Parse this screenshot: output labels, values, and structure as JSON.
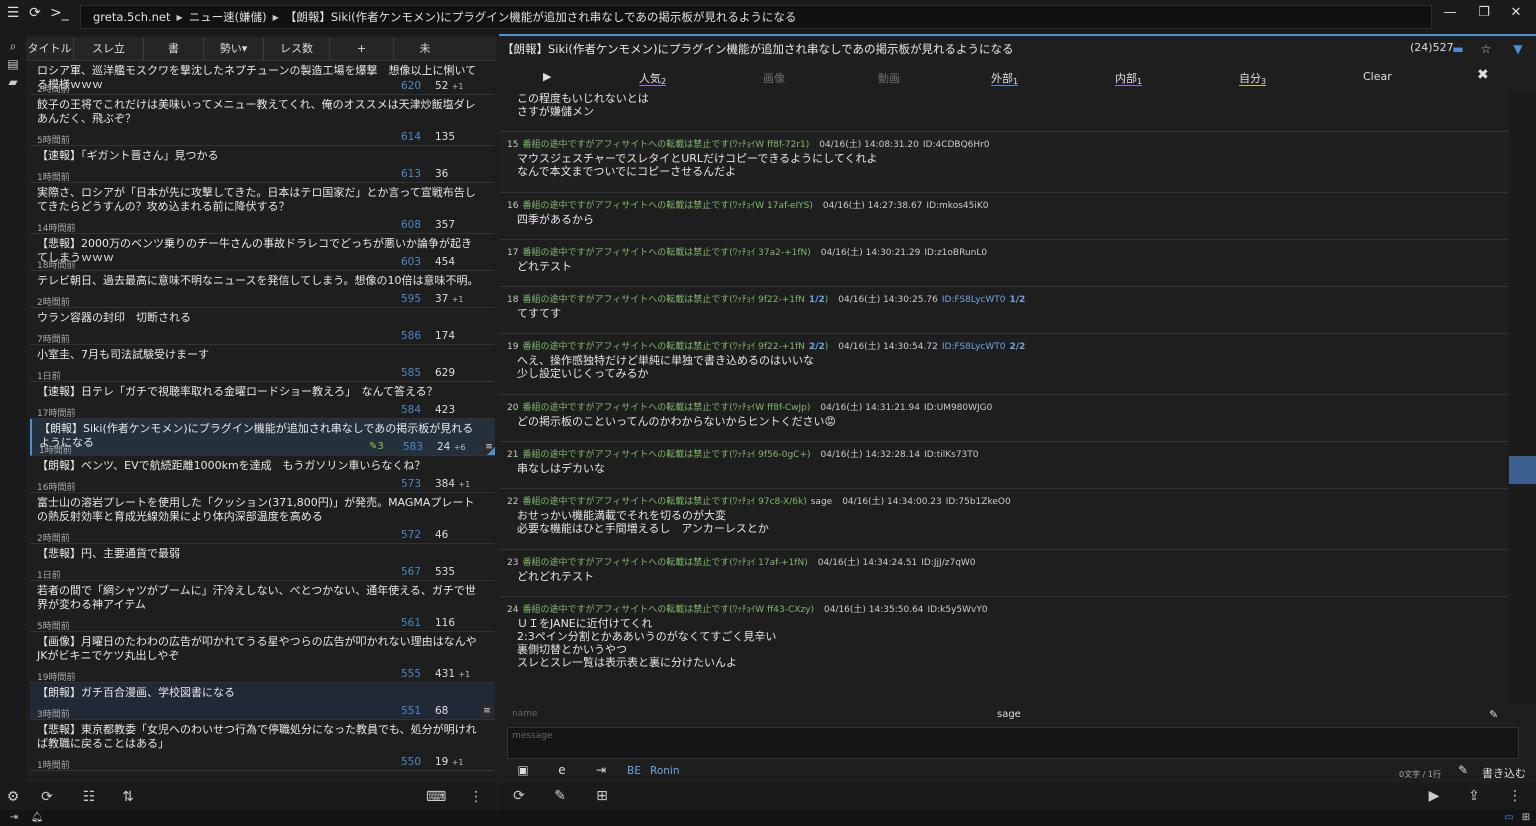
{
  "titlebar": {
    "crumbs": [
      "greta.5ch.net",
      "ニュー速(嫌儲)",
      "【朗報】Siki(作者ケンモメン)にプラグイン機能が追加され串なしであの掲示板が見れるようになる"
    ],
    "icons": [
      "menu-icon",
      "refresh-icon",
      "terminal-icon"
    ],
    "window_buttons": [
      "—",
      "❐",
      "✕"
    ]
  },
  "thread_header": {
    "columns": [
      "タイトル",
      "スレ立",
      "書",
      "勢い▾",
      "レス数",
      "+",
      "未"
    ]
  },
  "threads": [
    {
      "title": "ロシア軍、巡洋艦モスクワを撃沈したネプチューンの製造工場を爆撃　想像以上に悧いてる模様ｗｗｗ",
      "age": "2時間前",
      "num": "620",
      "cnt": "52",
      "plus": "+1"
    },
    {
      "title": "餃子の王将でこれだけは美味いってメニュー教えてくれ、俺のオススメは天津炒飯塩ダレあんだく、飛ぶぞ？",
      "age": "5時間前",
      "num": "614",
      "cnt": "135",
      "plus": ""
    },
    {
      "title": "【速報】「ギガント晋さん」見つかる",
      "age": "1時間前",
      "num": "613",
      "cnt": "36",
      "plus": ""
    },
    {
      "title": "実際さ、ロシアが「日本が先に攻撃してきた。日本はテロ国家だ」とか言って宣戦布告してきたらどうすんの？攻め込まれる前に降伏する？",
      "age": "14時間前",
      "num": "608",
      "cnt": "357",
      "plus": ""
    },
    {
      "title": "【悲報】2000万のベンツ乗りのチー牛さんの事故ドラレコでどっちが悪いか論争が起きてしまうｗｗｗ",
      "age": "18時間前",
      "num": "603",
      "cnt": "454",
      "plus": ""
    },
    {
      "title": "テレビ朝日、過去最高に意味不明なニュースを発信してしまう。想像の10倍は意味不明。",
      "age": "2時間前",
      "num": "595",
      "cnt": "37",
      "plus": "+1"
    },
    {
      "title": "ウラン容器の封印　切断される",
      "age": "7時間前",
      "num": "586",
      "cnt": "174",
      "plus": ""
    },
    {
      "title": "小室圭、7月も司法試験受けまーす",
      "age": "1日前",
      "num": "585",
      "cnt": "629",
      "plus": ""
    },
    {
      "title": "【速報】日テレ「ガチで視聴率取れる金曜ロードショー教えろ」　なんて答える？",
      "age": "17時間前",
      "num": "584",
      "cnt": "423",
      "plus": ""
    },
    {
      "title": "【朗報】Siki(作者ケンモメン)にプラグイン機能が追加され串なしであの掲示板が見れるようになる",
      "age": "1時間前",
      "num": "583",
      "cnt": "24",
      "plus": "+6",
      "edit": "3",
      "selected": true
    },
    {
      "title": "【朗報】ベンツ、EVで航続距離1000kmを達成　もうガソリン車いらなくね？",
      "age": "16時間前",
      "num": "573",
      "cnt": "384",
      "plus": "+1"
    },
    {
      "title": "富士山の溶岩プレートを使用した「クッション(371,800円)」が発売。MAGMAプレートの熱反射効率と育成光線効果により体内深部温度を高める",
      "age": "2時間前",
      "num": "572",
      "cnt": "46",
      "plus": ""
    },
    {
      "title": "【悲報】円、主要通貨で最弱",
      "age": "1日前",
      "num": "567",
      "cnt": "535",
      "plus": ""
    },
    {
      "title": "若者の間で「網シャツがブームに」汗冷えしない、べとつかない、通年使える、ガチで世界が変わる神アイテム",
      "age": "5時間前",
      "num": "561",
      "cnt": "116",
      "plus": ""
    },
    {
      "title": "【画像】月曜日のたわわの広告が叩かれてうる星やつらの広告が叩かれない理由はなんや JKがビキニでケツ丸出しやぞ",
      "age": "19時間前",
      "num": "555",
      "cnt": "431",
      "plus": "+1"
    },
    {
      "title": "【朗報】ガチ百合漫画、学校図書になる",
      "age": "3時間前",
      "num": "551",
      "cnt": "68",
      "plus": "",
      "highlight": true
    },
    {
      "title": "【悲報】東京都教委「女児へのわいせつ行為で停職処分になった教員でも、処分が明ければ教職に戻ることはある」",
      "age": "1時間前",
      "num": "550",
      "cnt": "19",
      "plus": "+1"
    }
  ],
  "right": {
    "title": "【朗報】Siki(作者ケンモメン)にプラグイン機能が追加され串なしであの掲示板が見れるようになる",
    "res_count": "(24)527",
    "tabs": [
      {
        "label": "▶",
        "sub": "",
        "dim": false
      },
      {
        "label": "人気",
        "sub": "2",
        "dim": false,
        "ul": "ul-purple"
      },
      {
        "label": "画像",
        "sub": "",
        "dim": true
      },
      {
        "label": "動画",
        "sub": "",
        "dim": true
      },
      {
        "label": "外部",
        "sub": "1",
        "dim": false,
        "ul": "ul-blue"
      },
      {
        "label": "内部",
        "sub": "1",
        "dim": false,
        "ul": "ul-purple"
      },
      {
        "label": "自分",
        "sub": "3",
        "dim": false,
        "ul": "ul-yellow"
      },
      {
        "label": "Clear",
        "sub": "",
        "dim": false
      }
    ],
    "clear_x": "✖",
    "first_body": "この程度もいじれないとは\nさすが嫌儲メン",
    "posts": [
      {
        "no": "15",
        "name": "番組の途中ですがアフィサイトへの転載は禁止です(ﾜｯﾁｮｲW ff8f-72r1)",
        "mail": "",
        "date": "04/16(土) 14:08:31.20",
        "id": "ID:4CDBQ6Hr0",
        "idcnt": "",
        "body": "マウスジェスチャーでスレタイとURLだけコピーできるようにしてくれよ\nなんで本文までついでにコピーさせるんだよ"
      },
      {
        "no": "16",
        "name": "番組の途中ですがアフィサイトへの転載は禁止です(ﾜｯﾁｮｲW 17af-eIYS)",
        "mail": "",
        "date": "04/16(土) 14:27:38.67",
        "id": "ID:mkos45iK0",
        "idcnt": "",
        "body": "四季があるから"
      },
      {
        "no": "17",
        "name": "番組の途中ですがアフィサイトへの転載は禁止です(ﾜｯﾁｮｲ 37a2-+1fN)",
        "mail": "",
        "date": "04/16(土) 14:30:21.29",
        "id": "ID:z1oBRunL0",
        "idcnt": "",
        "body": "どれテスト"
      },
      {
        "no": "18",
        "name": "番組の途中ですがアフィサイトへの転載は禁止です(ﾜｯﾁｮｲ 9f22-+1fN",
        "namecnt": "1/2",
        "mail": "",
        "date": "04/16(土) 14:30:25.76",
        "id": "ID:FS8LycWT0",
        "idcnt": "1/2",
        "body": "てすてす"
      },
      {
        "no": "19",
        "name": "番組の途中ですがアフィサイトへの転載は禁止です(ﾜｯﾁｮｲ 9f22-+1fN",
        "namecnt": "2/2",
        "mail": "",
        "date": "04/16(土) 14:30:54.72",
        "id": "ID:FS8LycWT0",
        "idcnt": "2/2",
        "body": "へえ、操作感独特だけど単純に単独で書き込めるのはいいな\n少し設定いじくってみるか"
      },
      {
        "no": "20",
        "name": "番組の途中ですがアフィサイトへの転載は禁止です(ﾜｯﾁｮｲW ff8f-CwJp)",
        "mail": "",
        "date": "04/16(土) 14:31:21.94",
        "id": "ID:UM980WJG0",
        "idcnt": "",
        "body": "どの掲示板のこといってんのかわからないからヒントください😡"
      },
      {
        "no": "21",
        "name": "番組の途中ですがアフィサイトへの転載は禁止です(ﾜｯﾁｮｲ 9f56-0gC+)",
        "mail": "",
        "date": "04/16(土) 14:32:28.14",
        "id": "ID:tilKs73T0",
        "idcnt": "",
        "body": "串なしはデカいな"
      },
      {
        "no": "22",
        "name": "番組の途中ですがアフィサイトへの転載は禁止です(ﾜｯﾁｮｲ 97c8-X/6k)",
        "mail": "sage",
        "date": "04/16(土) 14:34:00.23",
        "id": "ID:75b1ZkeO0",
        "idcnt": "",
        "body": "おせっかい機能満載でそれを切るのが大変\n必要な機能はひと手間増えるし　アンカーレスとか"
      },
      {
        "no": "23",
        "name": "番組の途中ですがアフィサイトへの転載は禁止です(ﾜｯﾁｮｲ 17af-+1fN)",
        "mail": "",
        "date": "04/16(土) 14:34:24.51",
        "id": "ID:JjJ/z7qW0",
        "idcnt": "",
        "body": "どれどれテスト"
      },
      {
        "no": "24",
        "name": "番組の途中ですがアフィサイトへの転載は禁止です(ﾜｯﾁｮｲW ff43-CXzy)",
        "mail": "",
        "date": "04/16(土) 14:35:50.64",
        "id": "ID:k5y5WvY0",
        "idcnt": "",
        "body": "ＵＩをJANEに近付けてくれ\n2:3ペイン分割とかああいうのがなくてすごく見辛い\n裏側切替とかいうやつ\nスレとスレ一覧は表示表と裏に分けたいんよ"
      }
    ]
  },
  "compose": {
    "name_placeholder": "name",
    "mail_value": "sage",
    "message_placeholder": "message",
    "be_label": "BE",
    "ronin_label": "Ronin",
    "char_count": "0文字 / 1行",
    "write_label": "書き込む"
  },
  "colors": {
    "accent": "#4a90d9",
    "name_green": "#7fb86c",
    "link_blue": "#4a88c7"
  }
}
